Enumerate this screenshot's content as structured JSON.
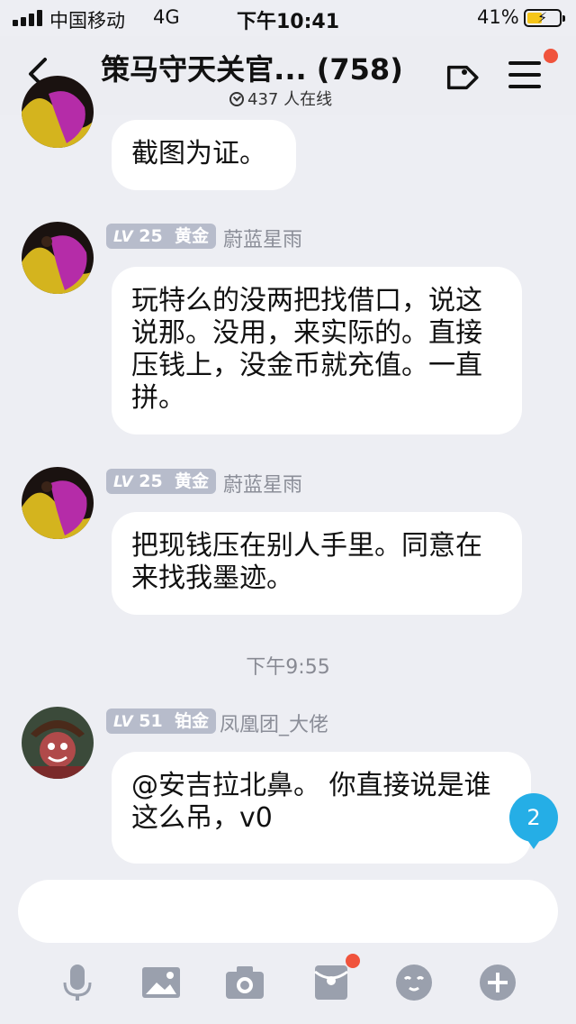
{
  "status": {
    "carrier": "中国移动",
    "network": "4G",
    "time": "下午10:41",
    "battery": "41%"
  },
  "header": {
    "title": "策马守天关官... (758)",
    "online": "437 人在线"
  },
  "messages": [
    {
      "text": "截图为证。"
    },
    {
      "level_prefix": "LV",
      "level_num": "25",
      "level_name": "黄金",
      "nickname": "蔚蓝星雨",
      "text": "玩特么的没两把找借口，说这说那。没用，来实际的。直接压钱上，没金币就充值。一直拼。"
    },
    {
      "level_prefix": "LV",
      "level_num": "25",
      "level_name": "黄金",
      "nickname": "蔚蓝星雨",
      "text": "把现钱压在别人手里。同意在来找我墨迹。"
    },
    {
      "level_prefix": "LV",
      "level_num": "51",
      "level_name": "铂金",
      "nickname": "凤凰团_大佬",
      "text": "@安吉拉北鼻。 你直接说是谁这么吊，v0"
    }
  ],
  "timestamp": "下午9:55",
  "unread_count": "2",
  "colors": {
    "background": "#edeef3",
    "bubble": "#ffffff",
    "level_badge": "#b7bccb",
    "unread_badge": "#25aee6",
    "notify_dot": "#f0533c",
    "icon_gray": "#9aa0ad"
  },
  "toolbar_icons": [
    "microphone-icon",
    "image-icon",
    "camera-icon",
    "red-packet-icon",
    "emoji-icon",
    "plus-icon"
  ]
}
